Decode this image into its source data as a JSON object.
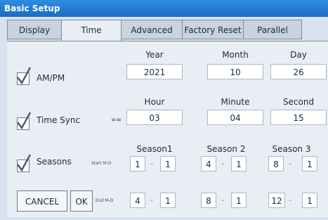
{
  "window": {
    "title": "Basic Setup"
  },
  "tabs": [
    {
      "label": "Display"
    },
    {
      "label": "Time"
    },
    {
      "label": "Advanced"
    },
    {
      "label": "Factory Reset"
    },
    {
      "label": "Parallel"
    }
  ],
  "active_tab": "Time",
  "date": {
    "checkbox_label": "AM/PM",
    "year_label": "Year",
    "year": "2021",
    "month_label": "Month",
    "month": "10",
    "day_label": "Day",
    "day": "26"
  },
  "time": {
    "checkbox_label": "Time Sync",
    "separator": "==",
    "hour_label": "Hour",
    "hour": "03",
    "minute_label": "Minute",
    "minute": "04",
    "second_label": "Second",
    "second": "15"
  },
  "seasons": {
    "checkbox_label": "Seasons",
    "start_label": "Start M-D",
    "end_label": "End M-D",
    "dash": "-",
    "season1": {
      "label": "Season1",
      "start_m": "1",
      "start_d": "1",
      "end_m": "4",
      "end_d": "1"
    },
    "season2": {
      "label": "Season 2",
      "start_m": "4",
      "start_d": "1",
      "end_m": "8",
      "end_d": "1"
    },
    "season3": {
      "label": "Season 3",
      "start_m": "8",
      "start_d": "1",
      "end_m": "12",
      "end_d": "1"
    }
  },
  "buttons": {
    "cancel": "CANCEL",
    "ok": "OK"
  },
  "checkboxes": {
    "am_pm": true,
    "time_sync": true,
    "seasons": true
  }
}
